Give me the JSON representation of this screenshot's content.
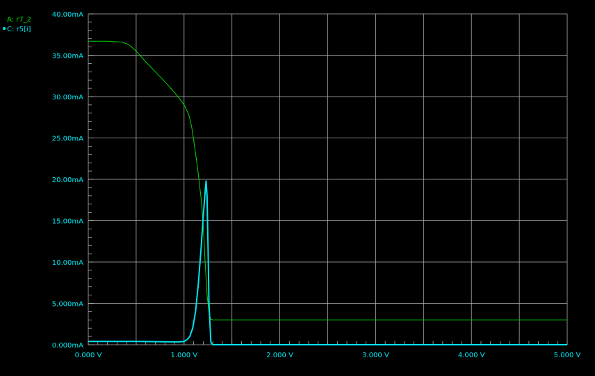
{
  "chart_data": {
    "type": "line",
    "xlabel": "",
    "ylabel": "",
    "xlim": [
      0,
      5
    ],
    "ylim": [
      0,
      40
    ],
    "grid": true,
    "legend_placement": "top-left",
    "x_ticks": [
      {
        "value": 0,
        "label": "0.000 V"
      },
      {
        "value": 1,
        "label": "1.000 V"
      },
      {
        "value": 2,
        "label": "2.000 V"
      },
      {
        "value": 3,
        "label": "3.000 V"
      },
      {
        "value": 4,
        "label": "4.000 V"
      },
      {
        "value": 5,
        "label": "5.000 V"
      }
    ],
    "y_ticks": [
      {
        "value": 0,
        "label": "0.000mA"
      },
      {
        "value": 5,
        "label": "5.000mA"
      },
      {
        "value": 10,
        "label": "10.00mA"
      },
      {
        "value": 15,
        "label": "15.00mA"
      },
      {
        "value": 20,
        "label": "20.00mA"
      },
      {
        "value": 25,
        "label": "25.00mA"
      },
      {
        "value": 30,
        "label": "30.00mA"
      },
      {
        "value": 35,
        "label": "35.00mA"
      },
      {
        "value": 40,
        "label": "40.00mA"
      }
    ],
    "series": [
      {
        "name": "A: r7_2",
        "color": "#00dd00",
        "marker": "none",
        "x": [
          0,
          0.2,
          0.35,
          0.42,
          0.5,
          0.6,
          0.7,
          0.8,
          0.9,
          0.95,
          1.0,
          1.05,
          1.08,
          1.1,
          1.13,
          1.15,
          1.18,
          1.2,
          1.22,
          1.24,
          1.26,
          1.27,
          1.28,
          1.3,
          2.0,
          3.0,
          4.0,
          5.0
        ],
        "y": [
          36.7,
          36.7,
          36.6,
          36.3,
          35.5,
          34.2,
          33.0,
          31.8,
          30.5,
          29.8,
          29.0,
          27.8,
          26.3,
          24.8,
          22.3,
          20.5,
          17.5,
          14.5,
          10.0,
          6.0,
          4.0,
          3.4,
          3.1,
          3.0,
          3.0,
          3.0,
          3.0,
          3.0
        ]
      },
      {
        "name": "C: r5[i]",
        "color": "#00e5ee",
        "marker": "dot",
        "x": [
          0,
          0.5,
          0.9,
          0.95,
          1.0,
          1.03,
          1.06,
          1.09,
          1.12,
          1.15,
          1.18,
          1.2,
          1.22,
          1.23,
          1.24,
          1.25,
          1.26,
          1.28,
          1.3,
          2.0,
          3.0,
          4.0,
          5.0
        ],
        "y": [
          0.4,
          0.4,
          0.35,
          0.35,
          0.4,
          0.6,
          1.0,
          2.0,
          4.0,
          7.5,
          12.0,
          15.5,
          18.5,
          19.8,
          18.0,
          12.0,
          5.0,
          0.3,
          0.0,
          0.0,
          0.0,
          0.0,
          0.0
        ]
      }
    ]
  }
}
